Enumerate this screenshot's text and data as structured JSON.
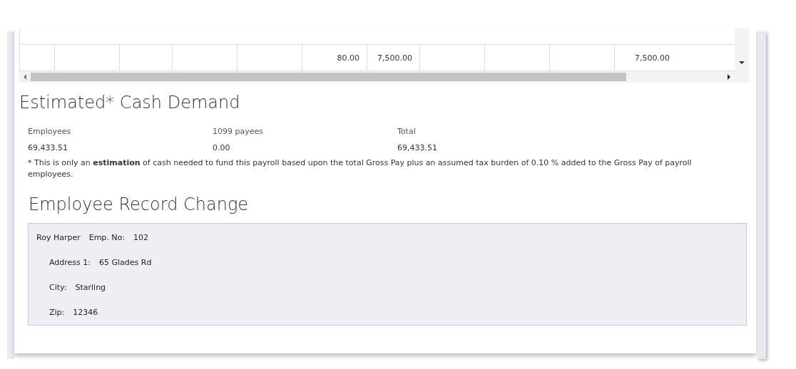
{
  "table": {
    "rows": [
      {
        "cells": [
          {},
          {},
          {},
          {},
          {},
          {
            "value": "80.00"
          },
          {
            "value": "7,500.00"
          },
          {},
          {},
          {},
          {
            "value": "7,500.00"
          }
        ]
      }
    ]
  },
  "cash_demand": {
    "title": "Estimated* Cash Demand",
    "columns": [
      {
        "label": "Employees",
        "value": "69,433.51"
      },
      {
        "label": "1099 payees",
        "value": "0.00"
      },
      {
        "label": "Total",
        "value": "69,433.51"
      }
    ],
    "note": "* This is only an **estimation** of cash needed to fund this payroll based upon the total Gross Pay plus an assumed tax burden of 0.10 % added to the Gross Pay of payroll employees."
  },
  "record_change": {
    "title": "Employee Record Change",
    "name": "Roy Harper",
    "emp_no_label": "Emp. No:",
    "emp_no": "102",
    "fields": [
      {
        "label": "Address 1:",
        "value": "65 Glades Rd"
      },
      {
        "label": "City:",
        "value": "Starling"
      },
      {
        "label": "Zip:",
        "value": "12346"
      }
    ]
  }
}
